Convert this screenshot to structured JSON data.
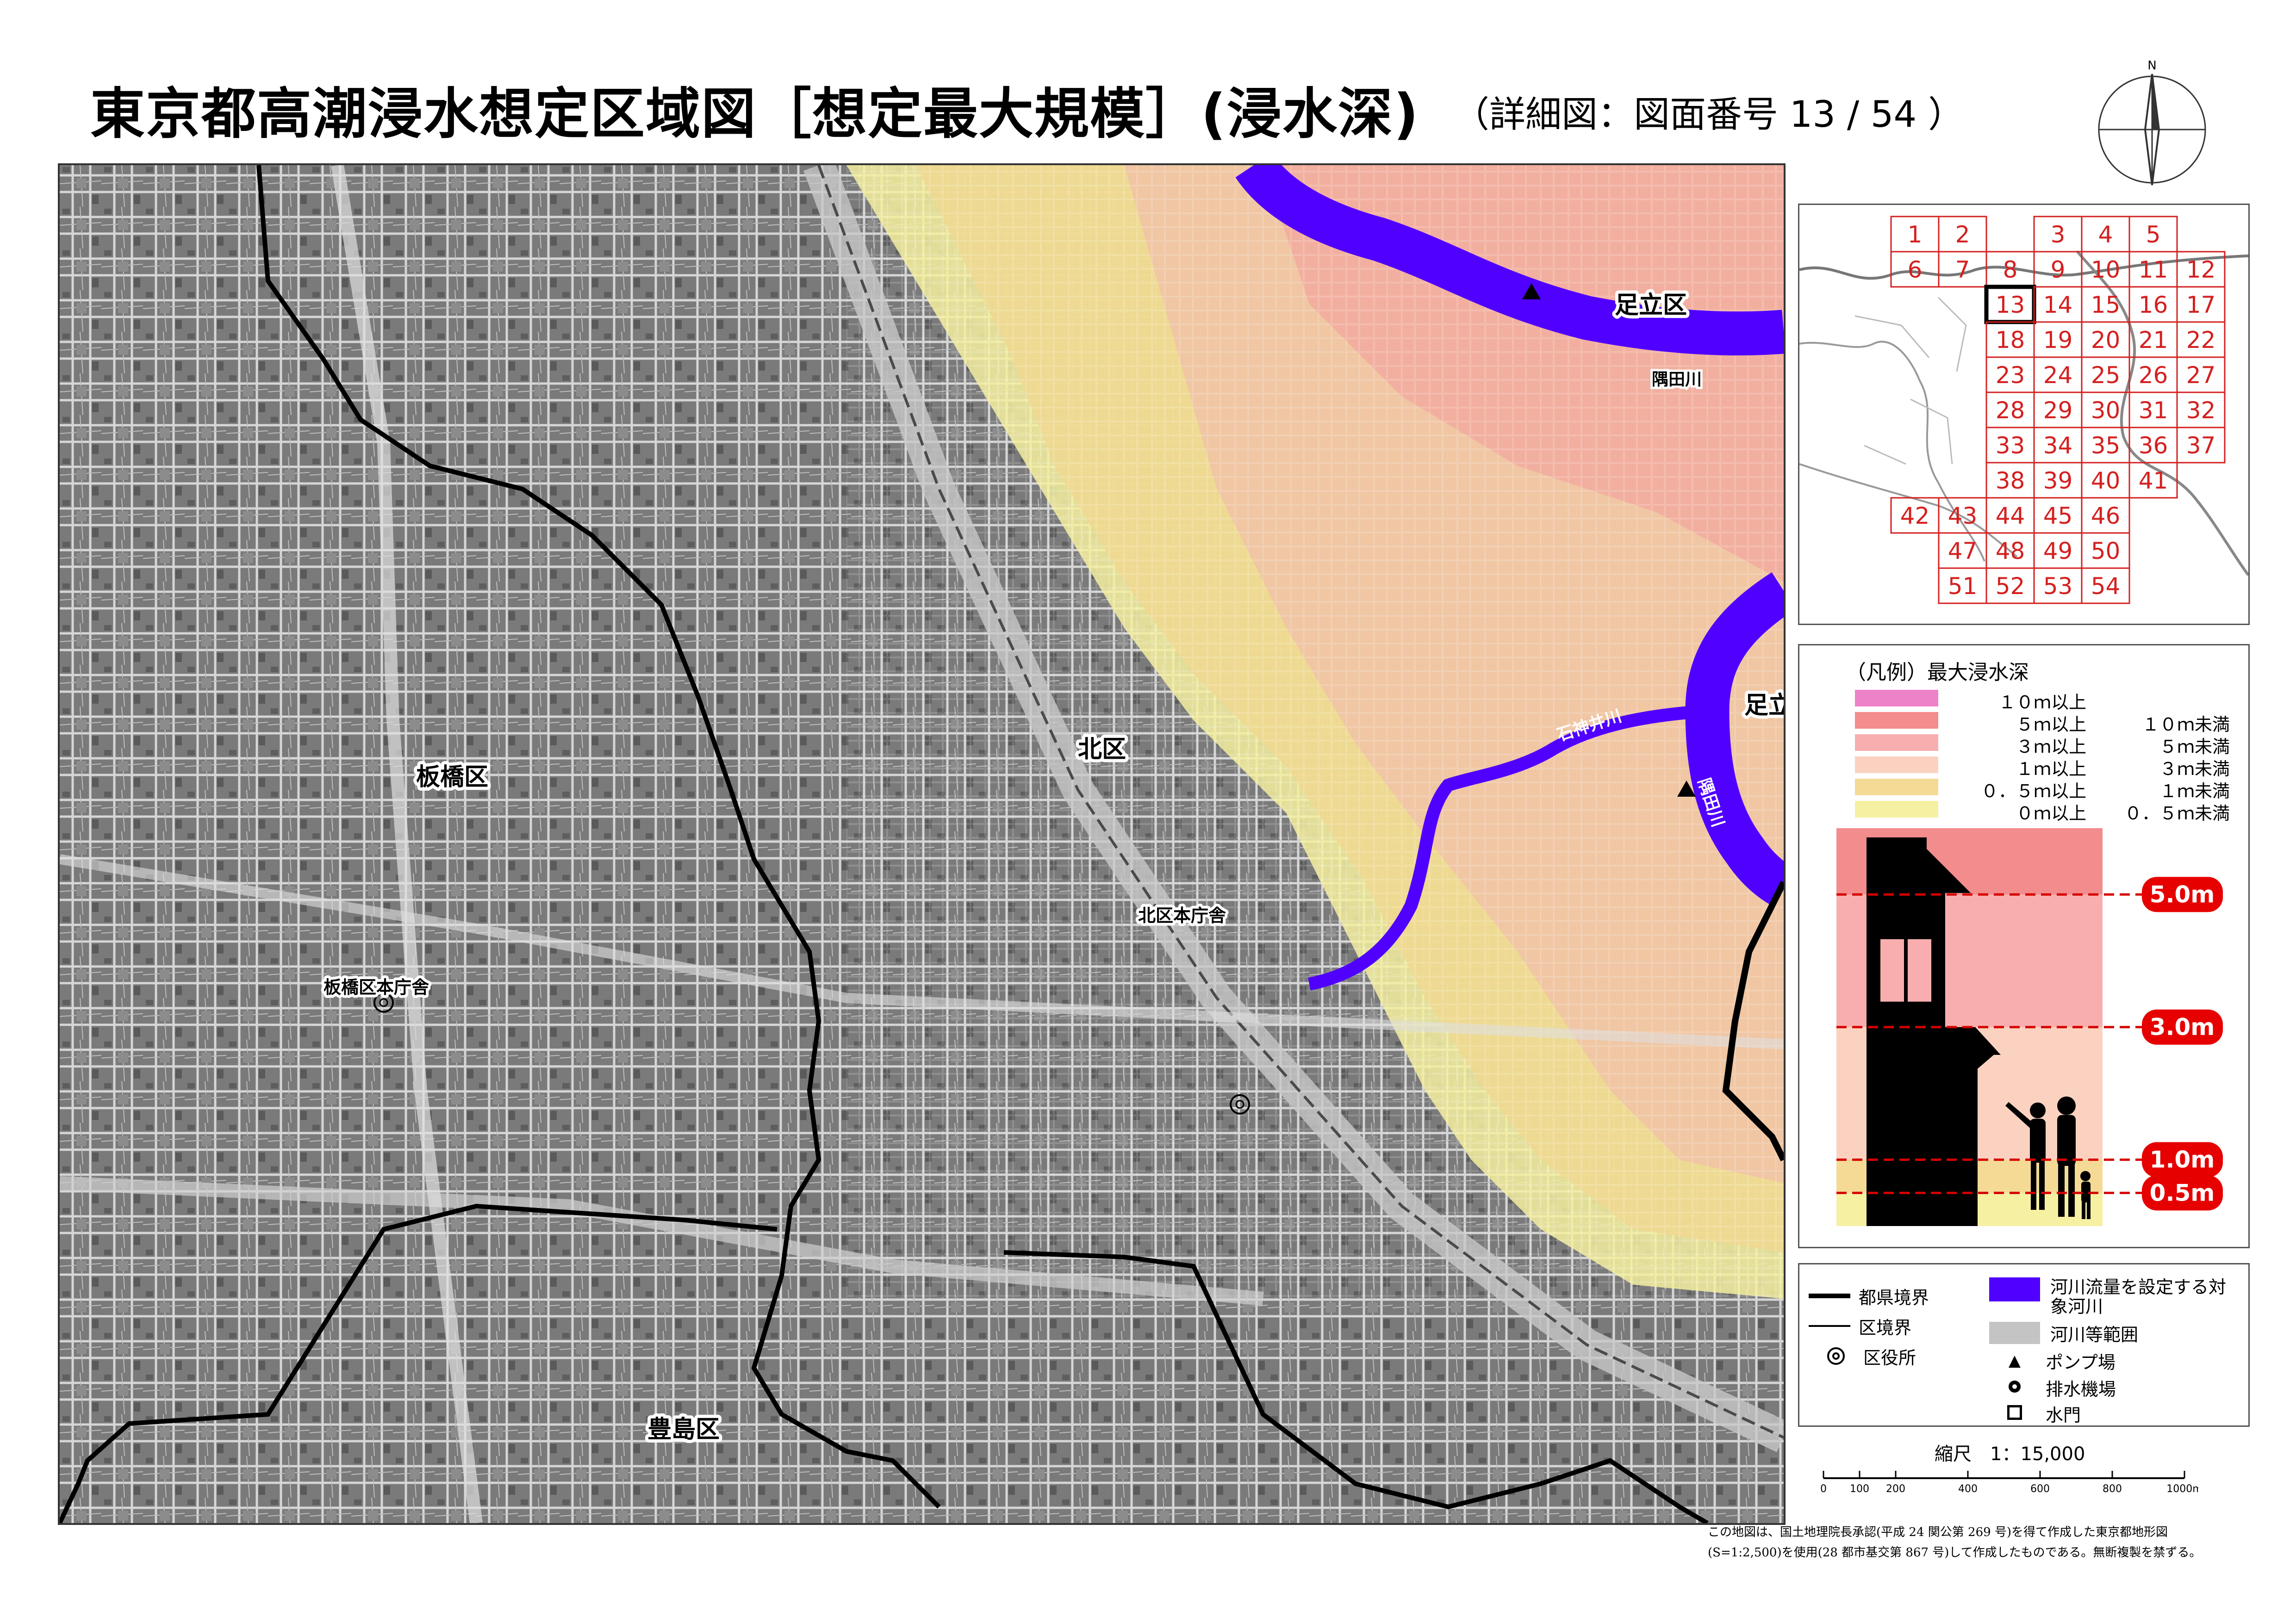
{
  "title": "東京都高潮浸水想定区域図［想定最大規模］(浸水深)",
  "subtitle": "（詳細図：図面番号 13 / 54 ）",
  "compass": {
    "north_label": "N"
  },
  "map": {
    "labels": {
      "adachi_north": "足立区",
      "adachi_east": "足立区",
      "kita": "北区",
      "itabashi": "板橋区",
      "toshima": "豊島区",
      "kita_office": "北区本庁舎",
      "itabashi_office": "板橋区本庁舎",
      "sumida_north": "隅田川",
      "sumida_east": "隅田川",
      "shakujii": "石神井川"
    },
    "colors": {
      "river": "#5000ff",
      "base": "#6e6e6e",
      "depth_3_5": "#f4a09c",
      "depth_1_3": "#f0c0a8",
      "depth_05_1": "#f0d890",
      "depth_0_05": "#f4f0a0"
    }
  },
  "index_map": {
    "sheets": [
      "1",
      "2",
      "3",
      "4",
      "5",
      "6",
      "7",
      "8",
      "9",
      "10",
      "11",
      "12",
      "13",
      "14",
      "15",
      "16",
      "17",
      "18",
      "19",
      "20",
      "21",
      "22",
      "23",
      "24",
      "25",
      "26",
      "27",
      "28",
      "29",
      "30",
      "31",
      "32",
      "33",
      "34",
      "35",
      "36",
      "37",
      "38",
      "39",
      "40",
      "41",
      "42",
      "43",
      "44",
      "45",
      "46",
      "47",
      "48",
      "49",
      "50",
      "51",
      "52",
      "53",
      "54"
    ],
    "current_sheet": "13",
    "grid_color": "#d42020"
  },
  "legend": {
    "title": "（凡例）最大浸水深",
    "rows": [
      {
        "lo": "１０ｍ以上",
        "hi": "",
        "color": "#ee82c8"
      },
      {
        "lo": "５ｍ以上",
        "hi": "１０ｍ未満",
        "color": "#f38c8c"
      },
      {
        "lo": "３ｍ以上",
        "hi": "５ｍ未満",
        "color": "#f8aeae"
      },
      {
        "lo": "１ｍ以上",
        "hi": "３ｍ未満",
        "color": "#fbd2c0"
      },
      {
        "lo": "０．５ｍ以上",
        "hi": "１ｍ未満",
        "color": "#f5da96"
      },
      {
        "lo": "０ｍ以上",
        "hi": "０．５ｍ未満",
        "color": "#f6f0a2"
      }
    ],
    "diagram": {
      "levels": [
        {
          "label": "5.0m",
          "depth_m": 5.0
        },
        {
          "label": "3.0m",
          "depth_m": 3.0
        },
        {
          "label": "1.0m",
          "depth_m": 1.0
        },
        {
          "label": "0.5m",
          "depth_m": 0.5
        }
      ],
      "max_depth_m": 6.0,
      "badge_color": "#e60000",
      "line_color": "#d60000"
    }
  },
  "symbols": {
    "pref_boundary": "都県境界",
    "ward_boundary": "区境界",
    "ward_office": "区役所",
    "river_flow": "河川流量を設定する対象河川",
    "river_area": "河川等範囲",
    "pump": "ポンプ場",
    "drainage": "排水機場",
    "sluice": "水門"
  },
  "scale": {
    "label": "縮尺　1：15,000",
    "ticks": [
      "0",
      "100",
      "200",
      "400",
      "600",
      "800",
      "1000m"
    ],
    "tick_values_m": [
      0,
      100,
      200,
      400,
      600,
      800,
      1000
    ]
  },
  "credit": "この地図は、国土地理院長承認(平成 24 関公第 269 号)を得て作成した東京都地形図(S=1:2,500)を使用(28 都市基交第 867 号)して作成したものである。無断複製を禁ずる。"
}
